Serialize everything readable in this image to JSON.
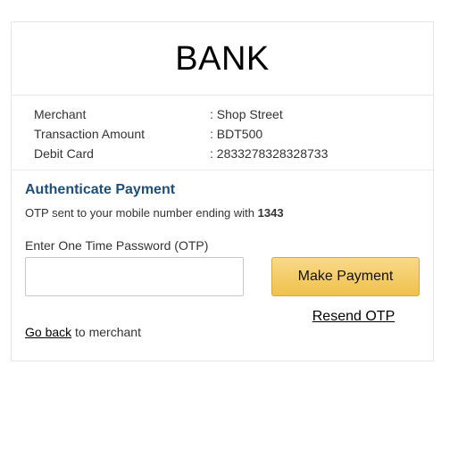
{
  "header": {
    "bank_name": "BANK"
  },
  "details": [
    {
      "label": "Merchant",
      "value": ": Shop Street"
    },
    {
      "label": "Transaction Amount",
      "value": ": BDT500"
    },
    {
      "label": "Debit Card",
      "value": ": 2833278328328733"
    }
  ],
  "auth": {
    "title": "Authenticate Payment",
    "otp_info_prefix": "OTP sent to your mobile number ending with ",
    "otp_last_digits": "1343",
    "otp_label": "Enter One Time Password (OTP)",
    "otp_value": "",
    "otp_placeholder": "",
    "pay_label": "Make Payment",
    "resend_label": "Resend OTP",
    "back_link_label": "Go back",
    "back_suffix": " to merchant"
  },
  "colors": {
    "title_blue": "#1f4e79",
    "button_yellow": "#f0c14b"
  }
}
